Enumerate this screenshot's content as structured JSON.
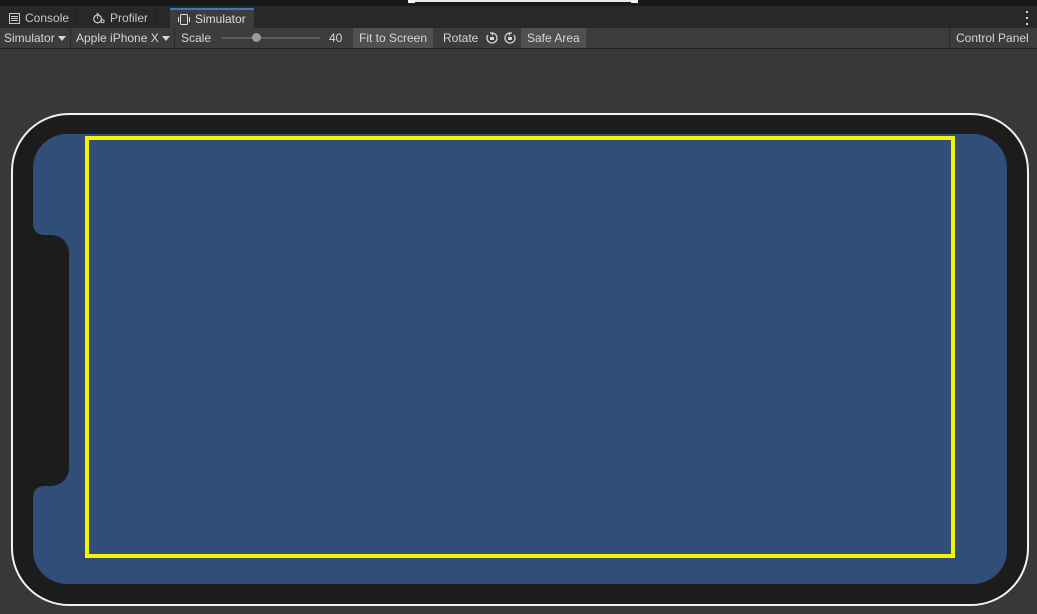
{
  "tabs": [
    {
      "label": "Console",
      "icon": "console-icon"
    },
    {
      "label": "Profiler",
      "icon": "profiler-icon"
    },
    {
      "label": "Simulator",
      "icon": "simulator-icon",
      "active": true
    }
  ],
  "toolbar": {
    "mode_dropdown": "Simulator",
    "device_dropdown": "Apple iPhone X",
    "scale_label": "Scale",
    "scale_value": "40",
    "fit_to_screen": "Fit to Screen",
    "rotate_label": "Rotate",
    "safe_area": "Safe Area",
    "control_panel": "Control Panel"
  },
  "colors": {
    "screen": "#304e77",
    "safe_area_outline": "#f5f500",
    "device_bezel": "#1c1c1c",
    "active_tab_accent": "#3a79bb"
  }
}
